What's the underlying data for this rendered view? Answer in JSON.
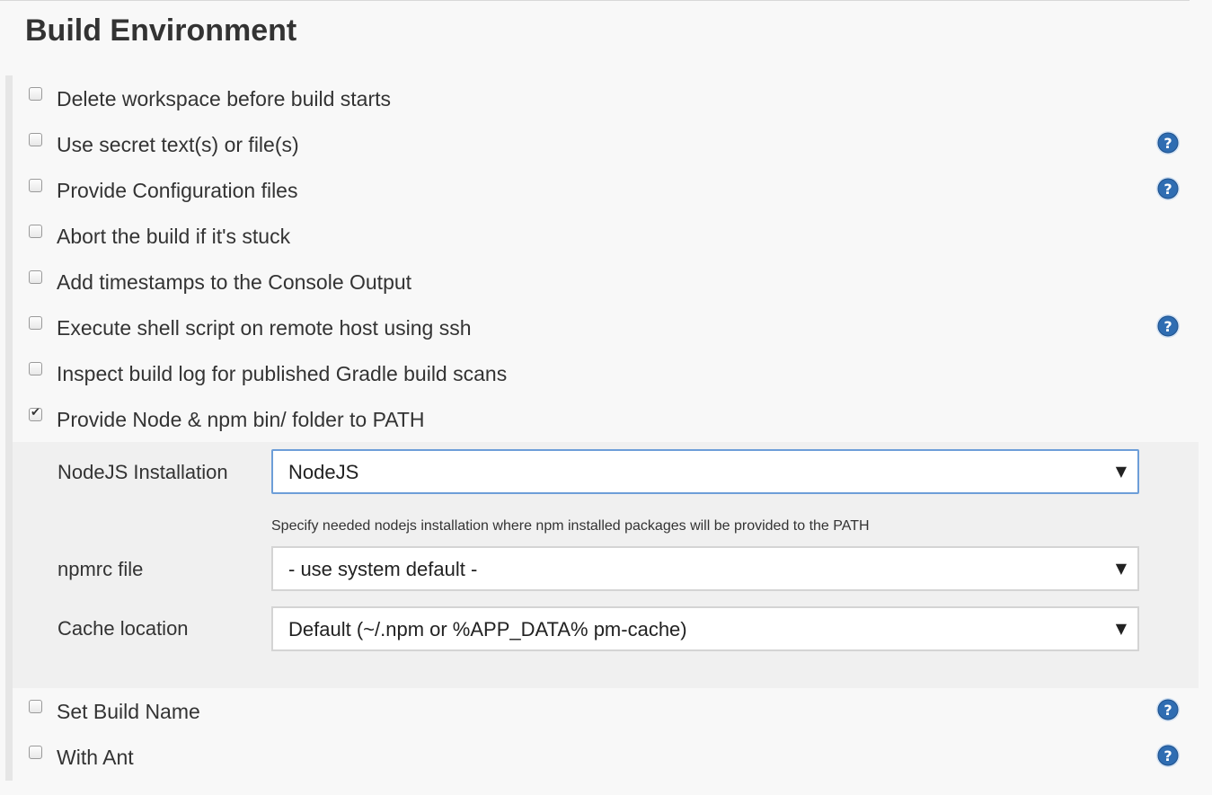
{
  "section": {
    "title": "Build Environment"
  },
  "options": [
    {
      "label": "Delete workspace before build starts",
      "checked": false,
      "has_help": false
    },
    {
      "label": "Use secret text(s) or file(s)",
      "checked": false,
      "has_help": true
    },
    {
      "label": "Provide Configuration files",
      "checked": false,
      "has_help": true
    },
    {
      "label": "Abort the build if it's stuck",
      "checked": false,
      "has_help": false
    },
    {
      "label": "Add timestamps to the Console Output",
      "checked": false,
      "has_help": false
    },
    {
      "label": "Execute shell script on remote host using ssh",
      "checked": false,
      "has_help": true
    },
    {
      "label": "Inspect build log for published Gradle build scans",
      "checked": false,
      "has_help": false
    },
    {
      "label": "Provide Node & npm bin/ folder to PATH",
      "checked": true,
      "has_help": false
    },
    {
      "label": "Set Build Name",
      "checked": false,
      "has_help": true
    },
    {
      "label": "With Ant",
      "checked": false,
      "has_help": true
    }
  ],
  "node_config": {
    "nodejs_installation": {
      "label": "NodeJS Installation",
      "value": "NodeJS",
      "description": "Specify needed nodejs installation where npm installed packages will be provided to the PATH"
    },
    "npmrc_file": {
      "label": "npmrc file",
      "value": "- use system default -"
    },
    "cache_location": {
      "label": "Cache location",
      "value": "Default (~/.npm or %APP_DATA% pm-cache)"
    }
  },
  "icons": {
    "help": "help-question-icon",
    "dropdown": "dropdown-arrow-icon",
    "checkmark": "checkmark-icon"
  },
  "colors": {
    "help_icon": "#2f6db2",
    "focus_border": "#6d9ed8",
    "page_background": "#f8f8f8",
    "panel_background": "#f0f0f0"
  }
}
